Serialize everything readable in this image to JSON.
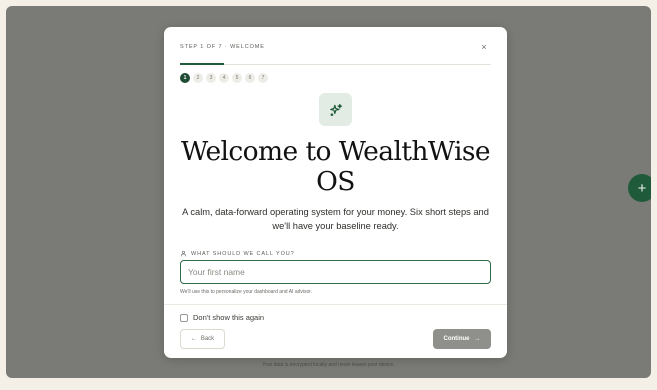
{
  "background": {
    "footer_note": "Your data is encrypted locally and never leaves your device.",
    "fab_symbol": "+"
  },
  "modal": {
    "step_label": "STEP 1 OF 7 · WELCOME",
    "close_symbol": "×",
    "progress": {
      "current": 1,
      "total": 7
    },
    "steps": [
      "1",
      "2",
      "3",
      "4",
      "5",
      "6",
      "7"
    ],
    "active_step": 1,
    "hero_icon": "sparkles-icon",
    "title_line1": "Welcome to WealthWise",
    "title_line2": "OS",
    "subtitle_line1": "A calm, data-forward operating system for your money. Six short steps and",
    "subtitle_line2": "we'll have your baseline ready.",
    "field_label": "WHAT SHOULD WE CALL YOU?",
    "field_icon": "user-icon",
    "name_placeholder": "Your first name",
    "name_value": "",
    "field_hint": "We'll use this to personalize your dashboard and AI advisor.",
    "checkbox_label": "Don't show this again",
    "checkbox_checked": false,
    "back_label": "Back",
    "continue_label": "Continue"
  },
  "colors": {
    "accent": "#1f5a3a",
    "overlay": "#7a7a76",
    "page_bg": "#f4efe7",
    "continue_disabled": "#8f8f8b"
  }
}
